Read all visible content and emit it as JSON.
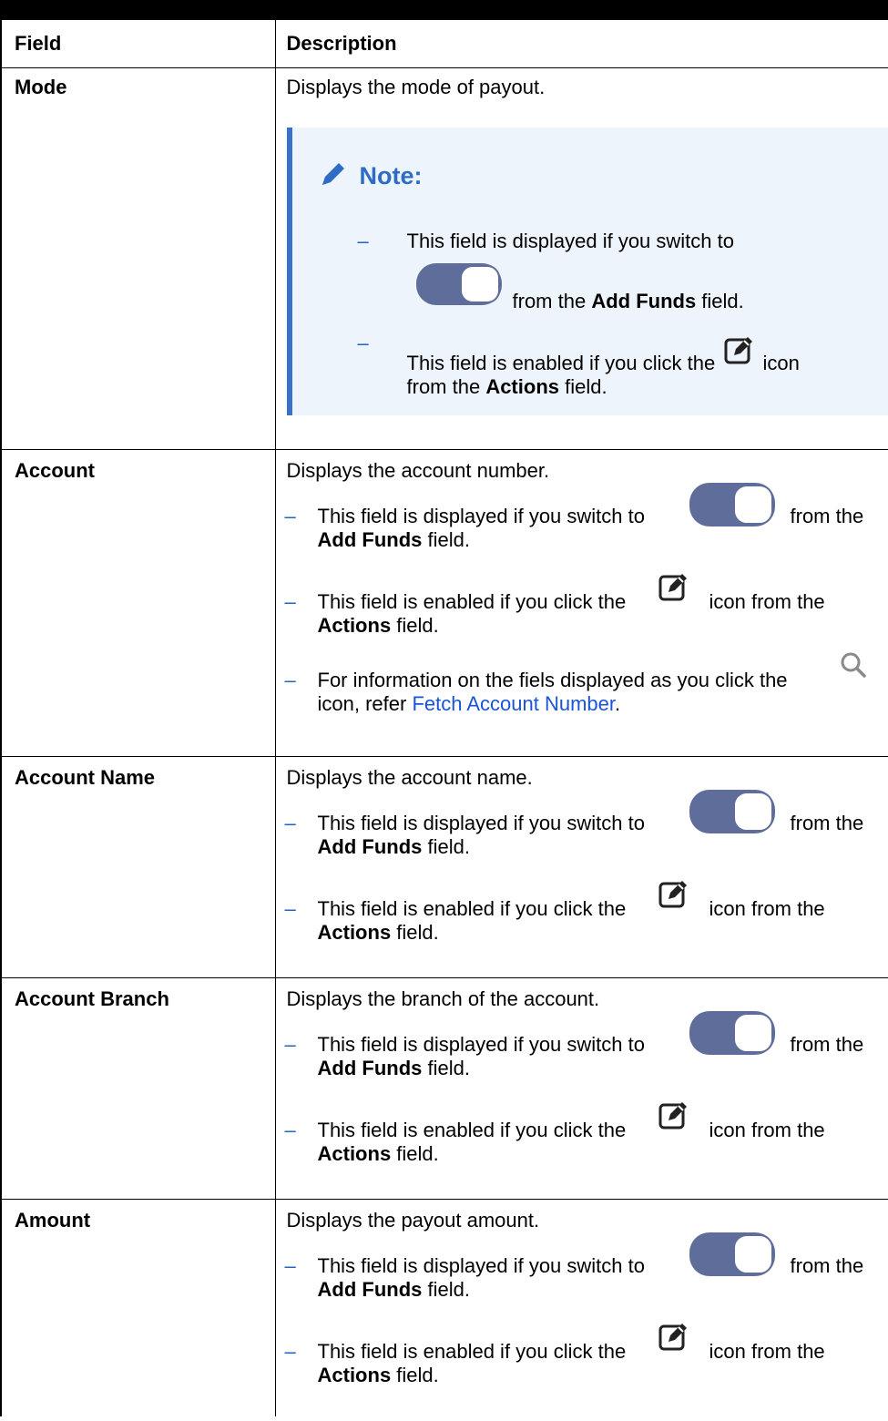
{
  "header": {
    "field": "Field",
    "description": "Description"
  },
  "rows": [
    {
      "field": "Mode",
      "desc": "Displays the mode of payout.",
      "note": {
        "title": "Note:",
        "b1_text": "This field is displayed if you switch to",
        "b1_pre": "from the ",
        "b1_bold": "Add Funds",
        "b1_post": " field.",
        "b2_text": "This field is enabled if you click the",
        "b2_icon_word": "icon",
        "b2_pre": "from the ",
        "b2_bold": "Actions",
        "b2_post": " field."
      }
    },
    {
      "field": "Account",
      "desc": "Displays the account number.",
      "b1_text": "This field is displayed if you switch to",
      "b1_tail": "from the",
      "b1_bold": "Add Funds",
      "b1_post": " field.",
      "b2_text": "This field is enabled if you click the",
      "b2_tail": "icon from the",
      "b2_bold": "Actions",
      "b2_post": " field.",
      "b3_text": "For information on the fiels displayed as you click the",
      "b3_pre": "icon, refer ",
      "b3_link": "Fetch Account Number",
      "b3_post": "."
    },
    {
      "field": "Account Name",
      "desc": "Displays the account name.",
      "b1_text": "This field is displayed if you switch to",
      "b1_tail": "from the",
      "b1_bold": "Add Funds",
      "b1_post": " field.",
      "b2_text": "This field is enabled if you click the",
      "b2_tail": "icon from the",
      "b2_bold": "Actions",
      "b2_post": " field."
    },
    {
      "field": "Account Branch",
      "desc": "Displays the branch of the account.",
      "b1_text": "This field is displayed if you switch to",
      "b1_tail": "from the",
      "b1_bold": "Add Funds",
      "b1_post": " field.",
      "b2_text": "This field is enabled if you click the",
      "b2_tail": "icon from the",
      "b2_bold": "Actions",
      "b2_post": " field."
    },
    {
      "field": "Amount",
      "desc": "Displays the payout amount.",
      "b1_text": "This field is displayed if you switch to",
      "b1_tail": "from the",
      "b1_bold": "Add Funds",
      "b1_post": " field.",
      "b2_text": "This field is enabled if you click the",
      "b2_tail": "icon from the",
      "b2_bold": "Actions",
      "b2_post": " field."
    }
  ],
  "dash": "–",
  "icons": {
    "toggle": "toggle-switch-icon",
    "edit": "edit-icon",
    "search": "search-icon",
    "pencil": "pencil-icon"
  },
  "colors": {
    "toggle": "#5f6d9a",
    "note_bg": "#eef4fc",
    "note_border": "#3a71c8",
    "note_title": "#2f6cc4",
    "link": "#1a55d6",
    "dash": "#1f66c4"
  }
}
